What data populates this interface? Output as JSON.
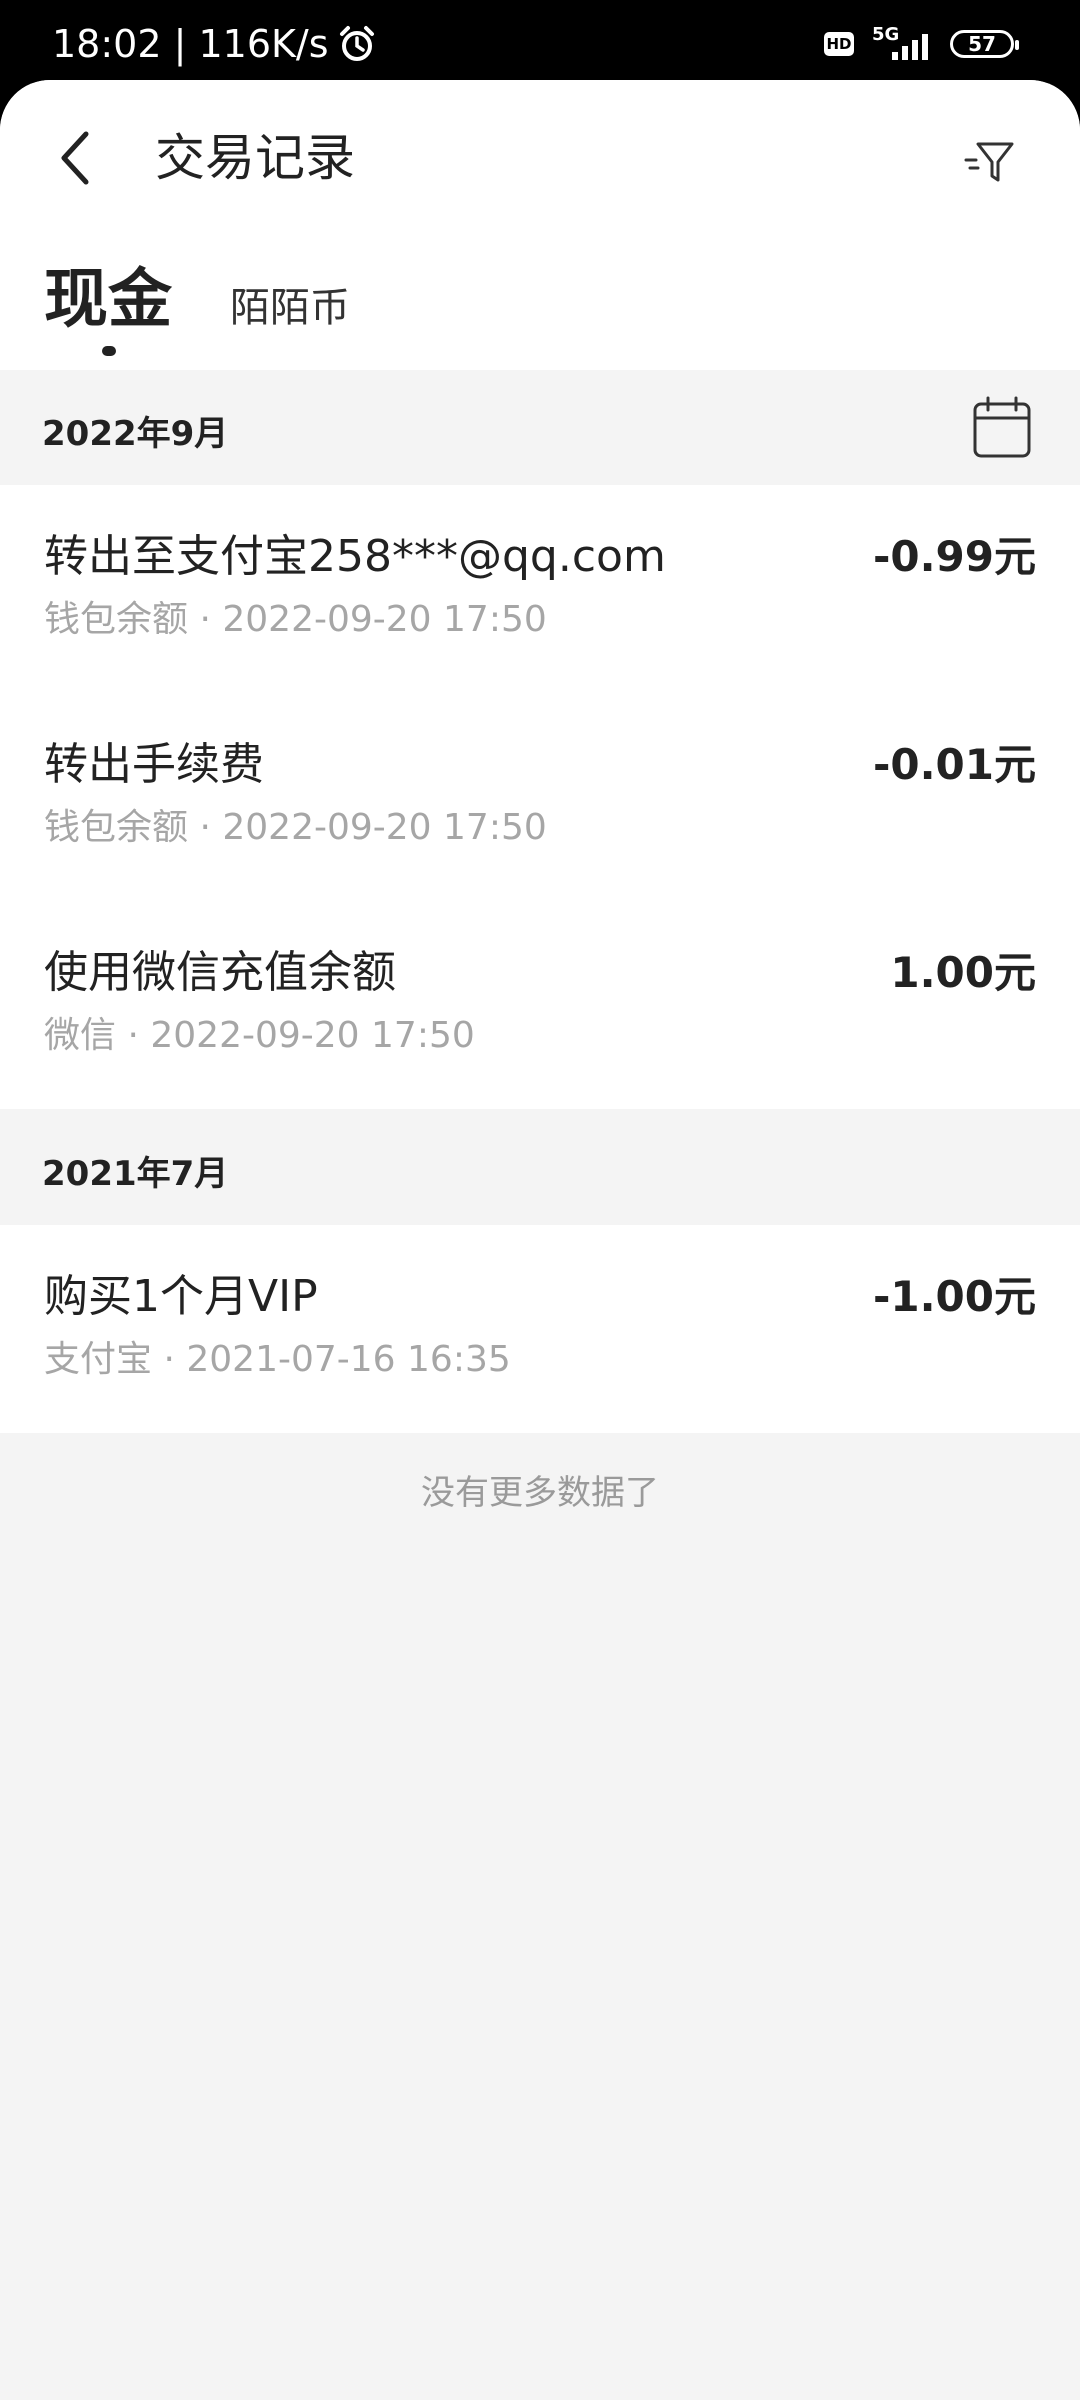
{
  "status_bar": {
    "time_speed": "18:02 | 116K/s",
    "network": "5G",
    "hd": "HD",
    "battery": "57"
  },
  "header": {
    "title": "交易记录"
  },
  "tabs": {
    "active": "现金",
    "inactive": "陌陌币"
  },
  "groups": [
    {
      "month": "2022年9月",
      "items": [
        {
          "title": "转出至支付宝258***@qq.com",
          "source": "钱包余额",
          "time": "2022-09-20 17:50",
          "amount": "-0.99元"
        },
        {
          "title": "转出手续费",
          "source": "钱包余额",
          "time": "2022-09-20 17:50",
          "amount": "-0.01元"
        },
        {
          "title": "使用微信充值余额",
          "source": "微信",
          "time": "2022-09-20 17:50",
          "amount": "1.00元"
        }
      ]
    },
    {
      "month": "2021年7月",
      "items": [
        {
          "title": "购买1个月VIP",
          "source": "支付宝",
          "time": "2021-07-16 16:35",
          "amount": "-1.00元"
        }
      ]
    }
  ],
  "footer": {
    "no_more": "没有更多数据了"
  }
}
